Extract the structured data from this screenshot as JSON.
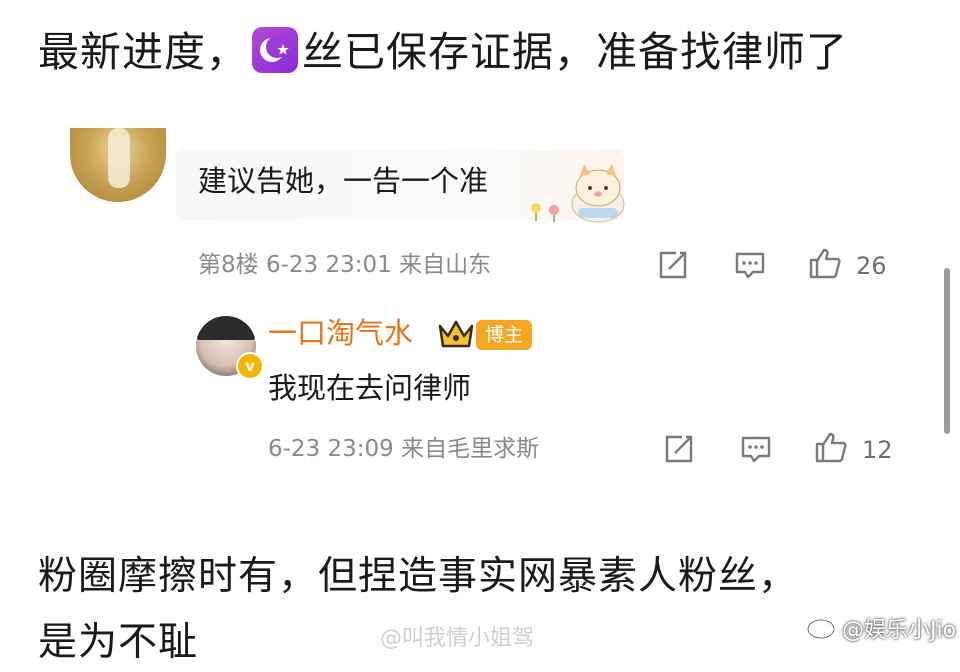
{
  "post": {
    "headline_part1": "最新进度，",
    "headline_part2": "丝已保存证据，准备找律师了",
    "headline_emoji": "moon-badge-emoji",
    "body_line1": "粉圈摩擦时有，但捏造事实网暴素人粉丝，",
    "body_line2": "是为不耻"
  },
  "comment": {
    "text": "建议告她，一告一个准",
    "floor": "第8楼",
    "time": "6-23 23:01",
    "location": "来自山东",
    "likes": "26",
    "icons": [
      "share-icon",
      "comment-icon",
      "like-icon"
    ]
  },
  "reply": {
    "username": "一口淘气水",
    "badge": "博主",
    "verified_mark": "v",
    "text": "我现在去问律师",
    "time": "6-23 23:09",
    "location": "来自毛里求斯",
    "likes": "12",
    "icons": [
      "share-icon",
      "comment-icon",
      "like-icon"
    ]
  },
  "watermark": {
    "faint": "@叫我情小姐驾",
    "main": "@娱乐小Jio"
  },
  "colors": {
    "username_orange": "#e8741a",
    "badge_orange": "#f5a623",
    "meta_gray": "#8a8a8a",
    "emoji_purple": "#9b3ad6"
  }
}
